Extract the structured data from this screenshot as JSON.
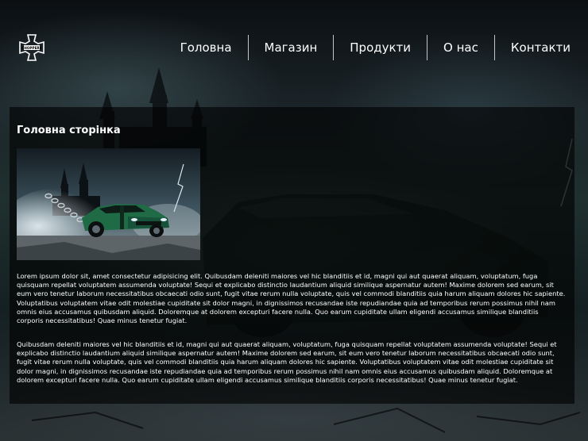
{
  "header": {
    "logo_icon": "choppers-iron-cross-logo",
    "logo_text": "CHOPPERS"
  },
  "nav": {
    "items": [
      {
        "label": "Головна"
      },
      {
        "label": "Магазин"
      },
      {
        "label": "Продукти"
      },
      {
        "label": "О нас"
      },
      {
        "label": "Контакти"
      }
    ]
  },
  "main": {
    "title": "Головна сторінка",
    "image_icon": "car-photo",
    "paragraphs": [
      "Lorem ipsum dolor sit, amet consectetur adipisicing elit. Quibusdam deleniti maiores vel hic blanditiis et id, magni qui aut quaerat aliquam, voluptatum, fuga quisquam repellat voluptatem assumenda voluptate! Sequi et explicabo distinctio laudantium aliquid similique aspernatur autem! Maxime dolorem sed earum, sit eum vero tenetur laborum necessitatibus obcaecati odio sunt, fugit vitae rerum nulla voluptate, quis vel commodi blanditiis quia harum aliquam dolores hic sapiente. Voluptatibus voluptatem vitae odit molestiae cupiditate sit dolor magni, in dignissimos recusandae iste repudiandae quia ad temporibus rerum possimus nihil nam omnis eius accusamus quibusdam aliquid. Doloremque at dolorem excepturi facere nulla. Quo earum cupiditate ullam eligendi accusamus similique blanditiis corporis necessitatibus! Quae minus tenetur fugiat.",
      "Quibusdam deleniti maiores vel hic blanditiis et id, magni qui aut quaerat aliquam, voluptatum, fuga quisquam repellat voluptatem assumenda voluptate! Sequi et explicabo distinctio laudantium aliquid similique aspernatur autem! Maxime dolorem sed earum, sit eum vero tenetur laborum necessitatibus obcaecati odio sunt, fugit vitae rerum nulla voluptate, quis vel commodi blanditiis quia harum aliquam dolores hic sapiente. Voluptatibus voluptatem vitae odit molestiae cupiditate sit dolor magni, in dignissimos recusandae iste repudiandae quia ad temporibus rerum possimus nihil nam omnis eius accusamus quibusdam aliquid. Doloremque at dolorem excepturi facere nulla. Quo earum cupiditate ullam eligendi accusamus similique blanditiis corporis necessitatibus! Quae minus tenetur fugiat."
    ]
  },
  "colors": {
    "text": "#ffffff",
    "panel_bg": "rgba(0,0,0,0.62)",
    "car_green": "#1f6b45"
  }
}
